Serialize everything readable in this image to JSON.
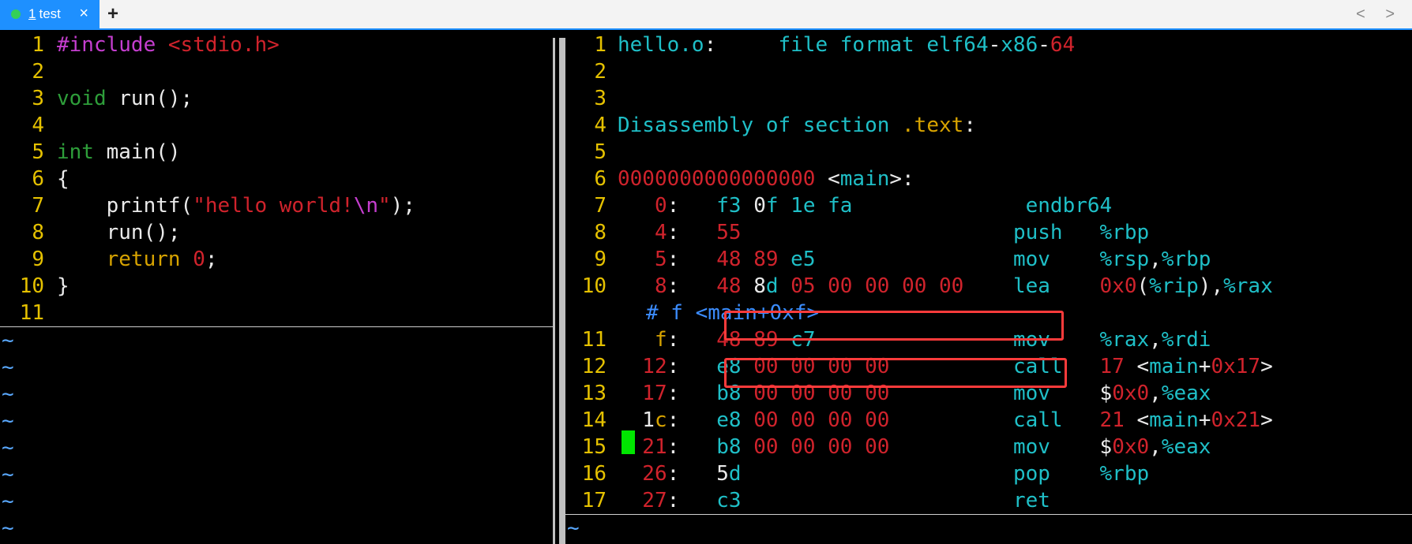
{
  "tab": {
    "number": "1",
    "title": "test",
    "close": "×"
  },
  "newtab": "+",
  "nav": "< >",
  "left": {
    "lines": [
      {
        "n": "1",
        "parts": [
          [
            "pp",
            "#include "
          ],
          [
            "str",
            "<stdio.h>"
          ]
        ]
      },
      {
        "n": "2",
        "parts": []
      },
      {
        "n": "3",
        "parts": [
          [
            "type",
            "void"
          ],
          [
            "def",
            " run();"
          ]
        ]
      },
      {
        "n": "4",
        "parts": []
      },
      {
        "n": "5",
        "parts": [
          [
            "type",
            "int"
          ],
          [
            "def",
            " main()"
          ]
        ]
      },
      {
        "n": "6",
        "parts": [
          [
            "def",
            "{"
          ]
        ]
      },
      {
        "n": "7",
        "parts": [
          [
            "def",
            "    printf("
          ],
          [
            "str",
            "\"hello world!"
          ],
          [
            "esc",
            "\\n"
          ],
          [
            "str",
            "\""
          ],
          [
            "def",
            ");"
          ]
        ]
      },
      {
        "n": "8",
        "parts": [
          [
            "def",
            "    run();"
          ]
        ]
      },
      {
        "n": "9",
        "parts": [
          [
            "kw",
            "    return "
          ],
          [
            "num",
            "0"
          ],
          [
            "def",
            ";"
          ]
        ]
      },
      {
        "n": "10",
        "parts": [
          [
            "def",
            "}"
          ]
        ]
      },
      {
        "n": "11",
        "parts": []
      }
    ],
    "tildes": [
      "~",
      "~",
      "~",
      "~",
      "~",
      "~",
      "~",
      "~"
    ]
  },
  "right": {
    "lines": [
      {
        "n": "1",
        "parts": [
          [
            "cyan",
            "hello.o"
          ],
          [
            "white",
            ":"
          ],
          [
            "cyan",
            "     file format elf64"
          ],
          [
            "white",
            "-"
          ],
          [
            "cyan",
            "x86"
          ],
          [
            "white",
            "-"
          ],
          [
            "red",
            "64"
          ]
        ]
      },
      {
        "n": "2",
        "parts": []
      },
      {
        "n": "3",
        "parts": []
      },
      {
        "n": "4",
        "parts": [
          [
            "cyan",
            "Disassembly of section "
          ],
          [
            "kw",
            ".text"
          ],
          [
            "white",
            ":"
          ]
        ]
      },
      {
        "n": "5",
        "parts": []
      },
      {
        "n": "6",
        "parts": [
          [
            "red",
            "0000000000000000"
          ],
          [
            "white",
            " <"
          ],
          [
            "cyan",
            "main"
          ],
          [
            "white",
            ">:"
          ]
        ]
      },
      {
        "n": "7",
        "parts": [
          [
            "red",
            "   0"
          ],
          [
            "white",
            ":   "
          ],
          [
            "cyan",
            "f3 "
          ],
          [
            "white",
            "0"
          ],
          [
            "cyan",
            "f 1e fa"
          ],
          [
            "white",
            "              "
          ],
          [
            "cyan",
            "endbr64"
          ]
        ]
      },
      {
        "n": "8",
        "parts": [
          [
            "red",
            "   4"
          ],
          [
            "white",
            ":   "
          ],
          [
            "red",
            "55"
          ],
          [
            "white",
            "                      "
          ],
          [
            "cyan",
            "push   %rbp"
          ]
        ]
      },
      {
        "n": "9",
        "parts": [
          [
            "red",
            "   5"
          ],
          [
            "white",
            ":   "
          ],
          [
            "red",
            "48 89 "
          ],
          [
            "cyan",
            "e5"
          ],
          [
            "white",
            "                "
          ],
          [
            "cyan",
            "mov    %rsp"
          ],
          [
            "white",
            ","
          ],
          [
            "cyan",
            "%rbp"
          ]
        ]
      },
      {
        "n": "10",
        "parts": [
          [
            "red",
            "   8"
          ],
          [
            "white",
            ":   "
          ],
          [
            "red",
            "48 "
          ],
          [
            "white",
            "8"
          ],
          [
            "cyan",
            "d "
          ],
          [
            "red",
            "05 00 00 00 00"
          ],
          [
            "white",
            "    "
          ],
          [
            "cyan",
            "lea    "
          ],
          [
            "red",
            "0x0"
          ],
          [
            "white",
            "("
          ],
          [
            "cyan",
            "%rip"
          ],
          [
            "white",
            "),"
          ],
          [
            "cyan",
            "%rax"
          ]
        ]
      }
    ],
    "wrap": "# f <main+0xf>",
    "lines2": [
      {
        "n": "11",
        "parts": [
          [
            "kw",
            "   f"
          ],
          [
            "white",
            ":   "
          ],
          [
            "red",
            "48 89 "
          ],
          [
            "cyan",
            "c7"
          ],
          [
            "white",
            "                "
          ],
          [
            "cyan",
            "mov    %rax"
          ],
          [
            "white",
            ","
          ],
          [
            "cyan",
            "%rdi"
          ]
        ]
      },
      {
        "n": "12",
        "parts": [
          [
            "red",
            "  12"
          ],
          [
            "white",
            ":   "
          ],
          [
            "cyan",
            "e8 "
          ],
          [
            "red",
            "00 00 00 00"
          ],
          [
            "white",
            "          "
          ],
          [
            "cyan",
            "call   "
          ],
          [
            "red",
            "17"
          ],
          [
            "white",
            " <"
          ],
          [
            "cyan",
            "main"
          ],
          [
            "white",
            "+"
          ],
          [
            "red",
            "0x17"
          ],
          [
            "white",
            ">"
          ]
        ]
      },
      {
        "n": "13",
        "parts": [
          [
            "red",
            "  17"
          ],
          [
            "white",
            ":   "
          ],
          [
            "cyan",
            "b8 "
          ],
          [
            "red",
            "00 00 00 00"
          ],
          [
            "white",
            "          "
          ],
          [
            "cyan",
            "mov    "
          ],
          [
            "white",
            "$"
          ],
          [
            "red",
            "0x0"
          ],
          [
            "white",
            ","
          ],
          [
            "cyan",
            "%eax"
          ]
        ]
      },
      {
        "n": "14",
        "parts": [
          [
            "white",
            "  1"
          ],
          [
            "kw",
            "c"
          ],
          [
            "white",
            ":   "
          ],
          [
            "cyan",
            "e8 "
          ],
          [
            "red",
            "00 00 00 00"
          ],
          [
            "white",
            "          "
          ],
          [
            "cyan",
            "call   "
          ],
          [
            "red",
            "21"
          ],
          [
            "white",
            " <"
          ],
          [
            "cyan",
            "main"
          ],
          [
            "white",
            "+"
          ],
          [
            "red",
            "0x21"
          ],
          [
            "white",
            ">"
          ]
        ]
      },
      {
        "n": "15",
        "parts": [
          [
            "red",
            "  21"
          ],
          [
            "white",
            ":   "
          ],
          [
            "cyan",
            "b8 "
          ],
          [
            "red",
            "00 00 00 00"
          ],
          [
            "white",
            "          "
          ],
          [
            "cyan",
            "mov    "
          ],
          [
            "white",
            "$"
          ],
          [
            "red",
            "0x0"
          ],
          [
            "white",
            ","
          ],
          [
            "cyan",
            "%eax"
          ]
        ]
      },
      {
        "n": "16",
        "parts": [
          [
            "red",
            "  26"
          ],
          [
            "white",
            ":   "
          ],
          [
            "white",
            "5"
          ],
          [
            "cyan",
            "d"
          ],
          [
            "white",
            "                      "
          ],
          [
            "cyan",
            "pop    %rbp"
          ]
        ]
      },
      {
        "n": "17",
        "parts": [
          [
            "red",
            "  27"
          ],
          [
            "white",
            ":   "
          ],
          [
            "cyan",
            "c3"
          ],
          [
            "white",
            "                      "
          ],
          [
            "cyan",
            "ret"
          ]
        ]
      }
    ],
    "tildes": [
      "~"
    ]
  }
}
